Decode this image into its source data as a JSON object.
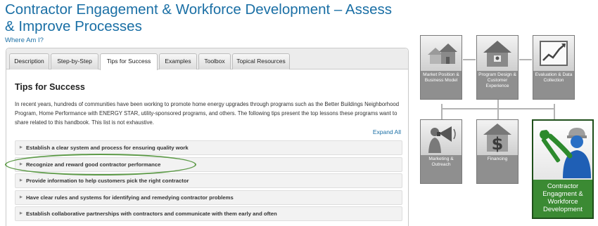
{
  "page": {
    "title": "Contractor Engagement & Workforce Development – Assess & Improve Processes",
    "where_link": "Where Am I?"
  },
  "tabs": [
    {
      "label": "Description",
      "active": false
    },
    {
      "label": "Step-by-Step",
      "active": false
    },
    {
      "label": "Tips for Success",
      "active": true
    },
    {
      "label": "Examples",
      "active": false
    },
    {
      "label": "Toolbox",
      "active": false
    },
    {
      "label": "Topical Resources",
      "active": false
    }
  ],
  "content": {
    "heading": "Tips for Success",
    "intro": "In recent years, hundreds of communities have been working to promote home energy upgrades through programs such as the Better Buildings Neighborhood Program, Home Performance with ENERGY STAR, utility-sponsored programs, and others. The following tips present the top lessons these programs want to share related to this handbook. This list is not exhaustive.",
    "expand_all": "Expand All",
    "tips": [
      "Establish a clear system and process for ensuring quality work",
      "Recognize and reward good contractor performance",
      "Provide information to help customers pick the right contractor",
      "Have clear rules and systems for identifying and remedying contractor problems",
      "Establish collaborative partnerships with contractors and communicate with them early and often"
    ]
  },
  "diagram": {
    "market": "Market Position & Business Model",
    "design": "Program Design & Customer Experience",
    "evaluation": "Evaluation & Data Collection",
    "marketing": "Marketing & Outreach",
    "financing": "Financing",
    "contractor": "Contractor Engagment & Workforce Development"
  },
  "colors": {
    "link_blue": "#1a6fa5",
    "active_green": "#3b8a33",
    "highlight_oval": "#5d9a48",
    "node_gray": "#8f8f8f"
  }
}
